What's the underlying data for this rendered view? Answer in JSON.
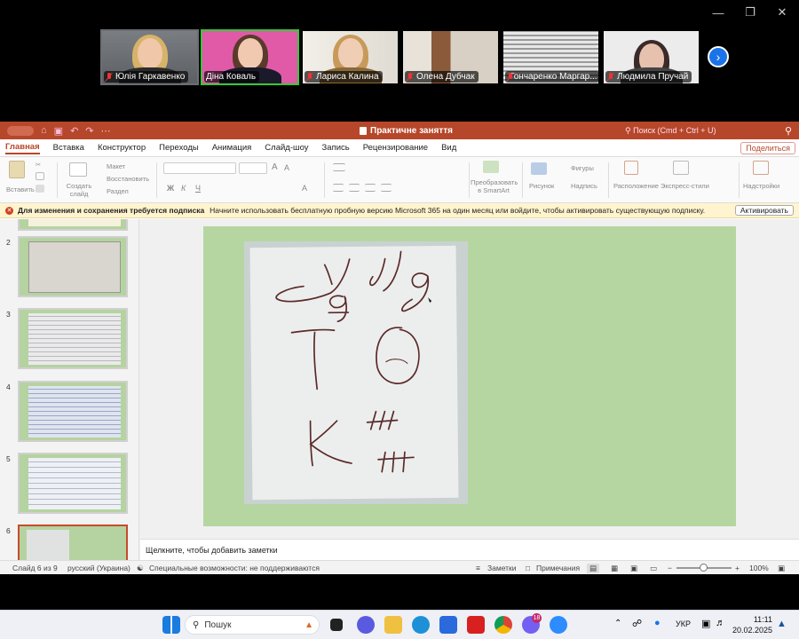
{
  "window": {
    "minimize_icon": "minimize-icon",
    "restore_icon": "restore-icon",
    "close_icon": "close-icon"
  },
  "participants": [
    {
      "name": "Юлія Гаркавенко",
      "bg": "#6b6f73",
      "active": false
    },
    {
      "name": "Діна Коваль",
      "bg": "#e05aa8",
      "active": true
    },
    {
      "name": "Лариса Калина",
      "bg": "#e9e6e0",
      "active": false
    },
    {
      "name": "Олена Дубчак",
      "bg": "#bfb3a5",
      "active": false
    },
    {
      "name": "Гончаренко Маргар...",
      "bg": "#3e3a36",
      "active": false
    },
    {
      "name": "Людмила  Пручай",
      "bg": "#e8e8e8",
      "active": false
    }
  ],
  "ppt": {
    "title": "Практичне заняття",
    "search_placeholder": "Поиск (Cmd + Ctrl + U)",
    "tabs": [
      "Главная",
      "Вставка",
      "Конструктор",
      "Переходы",
      "Анимация",
      "Слайд-шоу",
      "Запись",
      "Рецензирование",
      "Вид"
    ],
    "share_label": "Поделиться",
    "ribbon": {
      "paste": "Вставить",
      "new_slide": "Создать слайд",
      "layout": "Макет",
      "reset": "Восстановить",
      "section": "Раздел",
      "smartart": "Преобразовать в SmartArt",
      "picture": "Рисунок",
      "shapes": "Фигуры",
      "textbox": "Надпись",
      "arrange": "Расположение",
      "quick_styles": "Экспресс-стили",
      "designer": "Надстройки"
    },
    "notice": {
      "bold": "Для изменения и сохранения требуется подписка",
      "text": "Начните использовать бесплатную пробную версию Microsoft 365 на один месяц или войдите, чтобы активировать существующую подписку.",
      "button": "Активировать"
    },
    "thumbnails": [
      "2",
      "3",
      "4",
      "5",
      "6"
    ],
    "notes_placeholder": "Щелкните, чтобы добавить заметки",
    "status": {
      "slide": "Слайд 6 из 9",
      "language": "русский (Украина)",
      "accessibility": "Специальные возможности: не поддерживаются",
      "notes": "Заметки",
      "comments": "Примечания",
      "zoom": "100%"
    }
  },
  "taskbar": {
    "search": "Пошук",
    "lang": "УКР",
    "time": "11:11",
    "date": "20.02.2025",
    "badge": "18"
  }
}
